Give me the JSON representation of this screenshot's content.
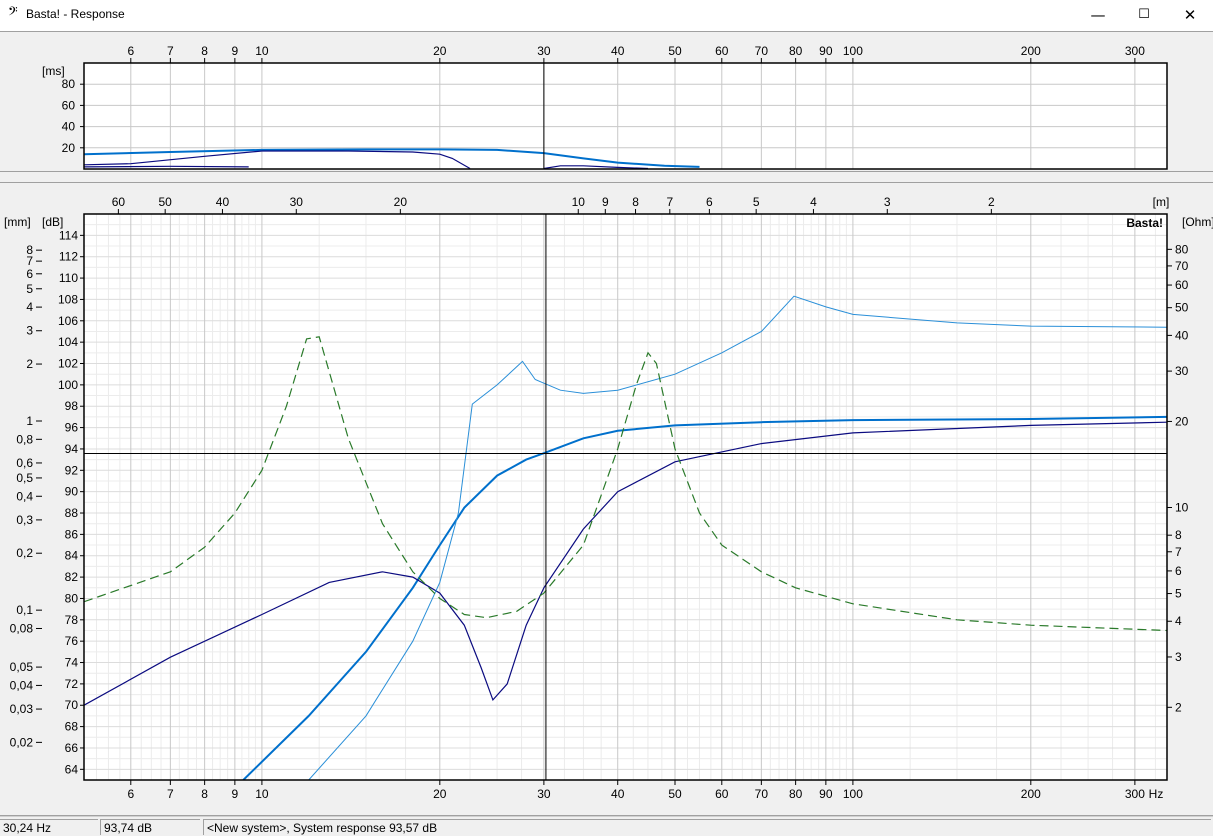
{
  "window": {
    "title": "Basta! - Response",
    "icon": "bass-clef-icon",
    "controls": {
      "minimize": "—",
      "maximize": "☐",
      "close": "✕"
    }
  },
  "status": {
    "frequency": "30,24 Hz",
    "level": "93,74 dB",
    "message": "<New system>, System response 93,57 dB"
  },
  "chart_data": [
    {
      "type": "line",
      "name": "group-delay-plot",
      "x_scale": "log",
      "xlim": [
        5,
        340
      ],
      "x_ticks": [
        6,
        7,
        8,
        9,
        10,
        20,
        30,
        40,
        50,
        60,
        70,
        80,
        90,
        100,
        200,
        300
      ],
      "ylabel": "[ms]",
      "ylim": [
        0,
        100
      ],
      "y_ticks": [
        20,
        40,
        60,
        80
      ],
      "cursor_x": 30,
      "colors": {
        "series1": "#0070cc",
        "series2": "#0b0b80"
      },
      "series": [
        {
          "points": [
            [
              5,
              14
            ],
            [
              7,
              16
            ],
            [
              10,
              18
            ],
            [
              15,
              18.5
            ],
            [
              20,
              18.5
            ],
            [
              25,
              18
            ],
            [
              30,
              15
            ],
            [
              35,
              10
            ],
            [
              40,
              6
            ],
            [
              48,
              3
            ],
            [
              55,
              2
            ]
          ]
        },
        {
          "points": [
            [
              5,
              4
            ],
            [
              6,
              5
            ],
            [
              8,
              12
            ],
            [
              10,
              17
            ],
            [
              14,
              17
            ],
            [
              18,
              16
            ],
            [
              20,
              14
            ],
            [
              21,
              10
            ],
            [
              22.5,
              0.5
            ]
          ]
        },
        {
          "points": [
            [
              5,
              2
            ],
            [
              7,
              2.5
            ],
            [
              9.5,
              2
            ]
          ]
        },
        {
          "points": [
            [
              30,
              0.5
            ],
            [
              32,
              3
            ],
            [
              35,
              3
            ],
            [
              40,
              1.5
            ],
            [
              45,
              0.5
            ]
          ]
        }
      ]
    },
    {
      "type": "line",
      "name": "frequency-response-plot",
      "x_scale": "log",
      "xlim": [
        5,
        340
      ],
      "x_ticks": [
        6,
        7,
        8,
        9,
        10,
        20,
        30,
        40,
        50,
        60,
        70,
        80,
        90,
        100,
        200,
        300
      ],
      "x_unit": "Hz",
      "top_axis_label": "[m]",
      "top_ticks": [
        60,
        50,
        40,
        30,
        20,
        10,
        9,
        8,
        7,
        6,
        5,
        4,
        3,
        2
      ],
      "ylabel": "[dB]",
      "ylim": [
        63,
        116
      ],
      "y_ticks": [
        64,
        66,
        68,
        70,
        72,
        74,
        76,
        78,
        80,
        82,
        84,
        86,
        88,
        90,
        92,
        94,
        96,
        98,
        100,
        102,
        104,
        106,
        108,
        110,
        112,
        114
      ],
      "left2_label": "[mm]",
      "left2_ticks": [
        0.02,
        0.03,
        0.04,
        0.05,
        0.08,
        0.1,
        0.2,
        0.3,
        0.4,
        0.5,
        0.6,
        0.8,
        1,
        2,
        3,
        4,
        5,
        6,
        7,
        8
      ],
      "right_label": "[Ohm]",
      "right_ticks": [
        2,
        3,
        4,
        5,
        6,
        7,
        8,
        10,
        20,
        30,
        40,
        50,
        60,
        70,
        80
      ],
      "cursor": {
        "x": 30.24,
        "y": 93.57
      },
      "watermark": "Basta!",
      "colors": {
        "system": "#0070cc",
        "driver": "#0b0b80",
        "impedance": "#2a8fd8",
        "excursion": "#2a7a2a"
      },
      "series": [
        {
          "id": "system",
          "points": [
            [
              9.3,
              63
            ],
            [
              12,
              69
            ],
            [
              15,
              75
            ],
            [
              18,
              81
            ],
            [
              20,
              85
            ],
            [
              22,
              88.5
            ],
            [
              25,
              91.5
            ],
            [
              28,
              93
            ],
            [
              30,
              93.6
            ],
            [
              35,
              95
            ],
            [
              40,
              95.7
            ],
            [
              50,
              96.2
            ],
            [
              70,
              96.5
            ],
            [
              100,
              96.7
            ],
            [
              200,
              96.8
            ],
            [
              340,
              97
            ]
          ]
        },
        {
          "id": "driver",
          "points": [
            [
              5,
              70
            ],
            [
              7,
              74.5
            ],
            [
              10,
              78.5
            ],
            [
              13,
              81.5
            ],
            [
              16,
              82.5
            ],
            [
              18,
              82
            ],
            [
              20,
              80.5
            ],
            [
              22,
              77.5
            ],
            [
              23.5,
              73.5
            ],
            [
              24.6,
              70.5
            ],
            [
              26,
              72
            ],
            [
              28,
              77.5
            ],
            [
              30,
              81
            ],
            [
              35,
              86.5
            ],
            [
              40,
              90
            ],
            [
              50,
              92.8
            ],
            [
              70,
              94.5
            ],
            [
              100,
              95.5
            ],
            [
              200,
              96.2
            ],
            [
              340,
              96.5
            ]
          ]
        },
        {
          "id": "impedance",
          "points": [
            [
              12,
              63
            ],
            [
              15,
              69
            ],
            [
              18,
              76
            ],
            [
              20,
              81.5
            ],
            [
              21.5,
              88
            ],
            [
              22.7,
              98.2
            ],
            [
              25,
              100
            ],
            [
              27.6,
              102.2
            ],
            [
              29,
              100.5
            ],
            [
              32,
              99.5
            ],
            [
              35,
              99.2
            ],
            [
              40,
              99.5
            ],
            [
              50,
              101
            ],
            [
              60,
              103
            ],
            [
              70,
              105
            ],
            [
              79.5,
              108.3
            ],
            [
              90,
              107.3
            ],
            [
              100,
              106.6
            ],
            [
              150,
              105.8
            ],
            [
              200,
              105.5
            ],
            [
              340,
              105.4
            ]
          ]
        },
        {
          "id": "excursion",
          "dashed": true,
          "points": [
            [
              5,
              79.7
            ],
            [
              7,
              82.5
            ],
            [
              8,
              84.8
            ],
            [
              9,
              88
            ],
            [
              10,
              92
            ],
            [
              11,
              98
            ],
            [
              11.9,
              104.3
            ],
            [
              12.5,
              104.5
            ],
            [
              14,
              95
            ],
            [
              16,
              87
            ],
            [
              18,
              82.5
            ],
            [
              20,
              80
            ],
            [
              22,
              78.5
            ],
            [
              24,
              78.2
            ],
            [
              27,
              78.8
            ],
            [
              30,
              80.5
            ],
            [
              35,
              85
            ],
            [
              40,
              94
            ],
            [
              43,
              100
            ],
            [
              45,
              103
            ],
            [
              46.5,
              102
            ],
            [
              50,
              94
            ],
            [
              55,
              88
            ],
            [
              60,
              85
            ],
            [
              70,
              82.5
            ],
            [
              80,
              81
            ],
            [
              100,
              79.5
            ],
            [
              150,
              78
            ],
            [
              200,
              77.5
            ],
            [
              340,
              77
            ]
          ]
        }
      ]
    }
  ]
}
